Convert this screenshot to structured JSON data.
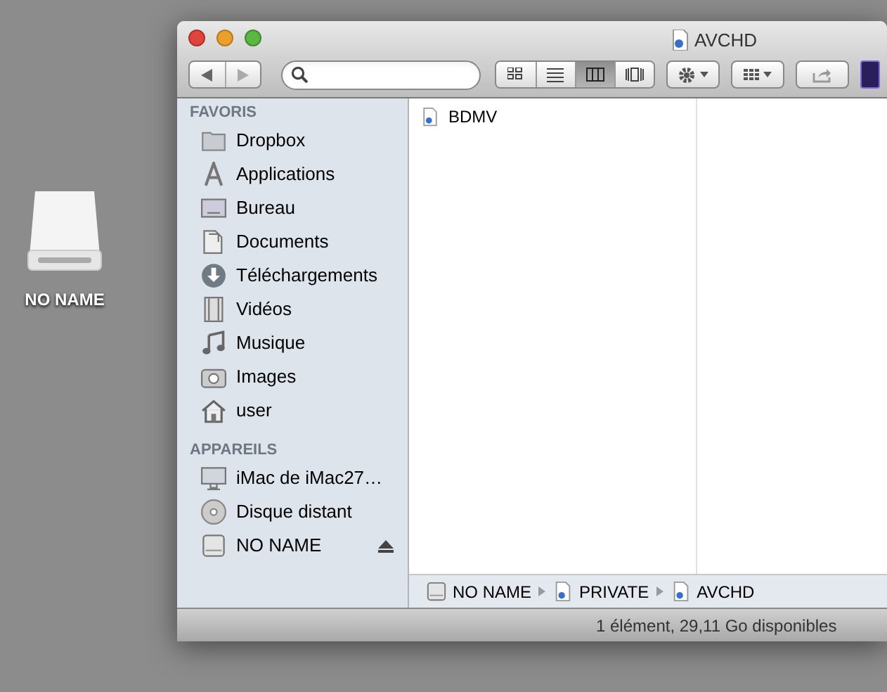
{
  "desktop": {
    "icon_label": "NO NAME"
  },
  "window": {
    "title": "AVCHD"
  },
  "toolbar": {
    "view_modes": [
      {
        "kind": "icons",
        "selected": false
      },
      {
        "kind": "list",
        "selected": false
      },
      {
        "kind": "columns",
        "selected": true
      },
      {
        "kind": "coverflow",
        "selected": false
      }
    ]
  },
  "sidebar": {
    "sections": [
      {
        "heading": "FAVORIS",
        "items": [
          {
            "kind": "folder",
            "label": "Dropbox"
          },
          {
            "kind": "apps",
            "label": "Applications"
          },
          {
            "kind": "desktop",
            "label": "Bureau"
          },
          {
            "kind": "documents",
            "label": "Documents"
          },
          {
            "kind": "downloads",
            "label": "Téléchargements"
          },
          {
            "kind": "movies",
            "label": "Vidéos"
          },
          {
            "kind": "music",
            "label": "Musique"
          },
          {
            "kind": "pictures",
            "label": "Images"
          },
          {
            "kind": "home",
            "label": "user"
          }
        ]
      },
      {
        "heading": "APPAREILS",
        "items": [
          {
            "kind": "computer",
            "label": "iMac de iMac27…"
          },
          {
            "kind": "disc",
            "label": "Disque distant"
          },
          {
            "kind": "drive",
            "label": "NO NAME",
            "ejectable": true
          }
        ]
      }
    ]
  },
  "columns": [
    [
      {
        "label": "BDMV"
      }
    ]
  ],
  "path_bar": [
    {
      "kind": "drive",
      "label": "NO NAME"
    },
    {
      "kind": "doc",
      "label": "PRIVATE"
    },
    {
      "kind": "doc",
      "label": "AVCHD"
    }
  ],
  "status_bar": "1 élément, 29,11 Go disponibles"
}
